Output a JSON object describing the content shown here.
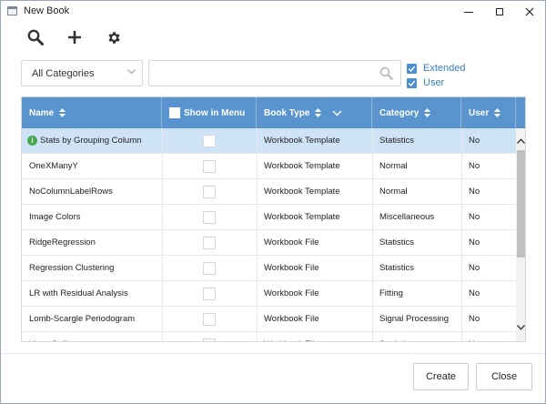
{
  "window": {
    "title": "New Book"
  },
  "toolbar": {
    "icons": [
      "search-icon",
      "plus-icon",
      "gear-icon"
    ]
  },
  "filter": {
    "category_value": "All Categories",
    "search_value": "",
    "search_placeholder": "",
    "extended_label": "Extended",
    "extended_checked": true,
    "user_label": "User",
    "user_checked": true
  },
  "table": {
    "headers": {
      "name": "Name",
      "show_in_menu": "Show in Menu",
      "book_type": "Book Type",
      "category": "Category",
      "user": "User"
    },
    "rows": [
      {
        "name": "Stats by Grouping Column",
        "book_type": "Workbook Template",
        "category": "Statistics",
        "user": "No",
        "selected": true,
        "has_info_icon": true
      },
      {
        "name": "OneXManyY",
        "book_type": "Workbook Template",
        "category": "Normal",
        "user": "No"
      },
      {
        "name": "NoColumnLabelRows",
        "book_type": "Workbook Template",
        "category": "Normal",
        "user": "No"
      },
      {
        "name": "Image Colors",
        "book_type": "Workbook Template",
        "category": "Miscellaneous",
        "user": "No"
      },
      {
        "name": "RidgeRegression",
        "book_type": "Workbook File",
        "category": "Statistics",
        "user": "No"
      },
      {
        "name": "Regression Clustering",
        "book_type": "Workbook File",
        "category": "Statistics",
        "user": "No"
      },
      {
        "name": "LR with Residual Analysis",
        "book_type": "Workbook File",
        "category": "Fitting",
        "user": "No"
      },
      {
        "name": "Lomb-Scargle Periodogram",
        "book_type": "Workbook File",
        "category": "Signal Processing",
        "user": "No"
      },
      {
        "name": "Venn Collins",
        "book_type": "Workbook File",
        "category": "Statistics",
        "user": "No"
      }
    ]
  },
  "buttons": {
    "create": "Create",
    "close": "Close"
  },
  "colors": {
    "header_bg": "#5a94cf",
    "selected_row": "#cfe3f7",
    "checkbox_blue": "#4d8fd1",
    "info_green": "#47a84f"
  }
}
